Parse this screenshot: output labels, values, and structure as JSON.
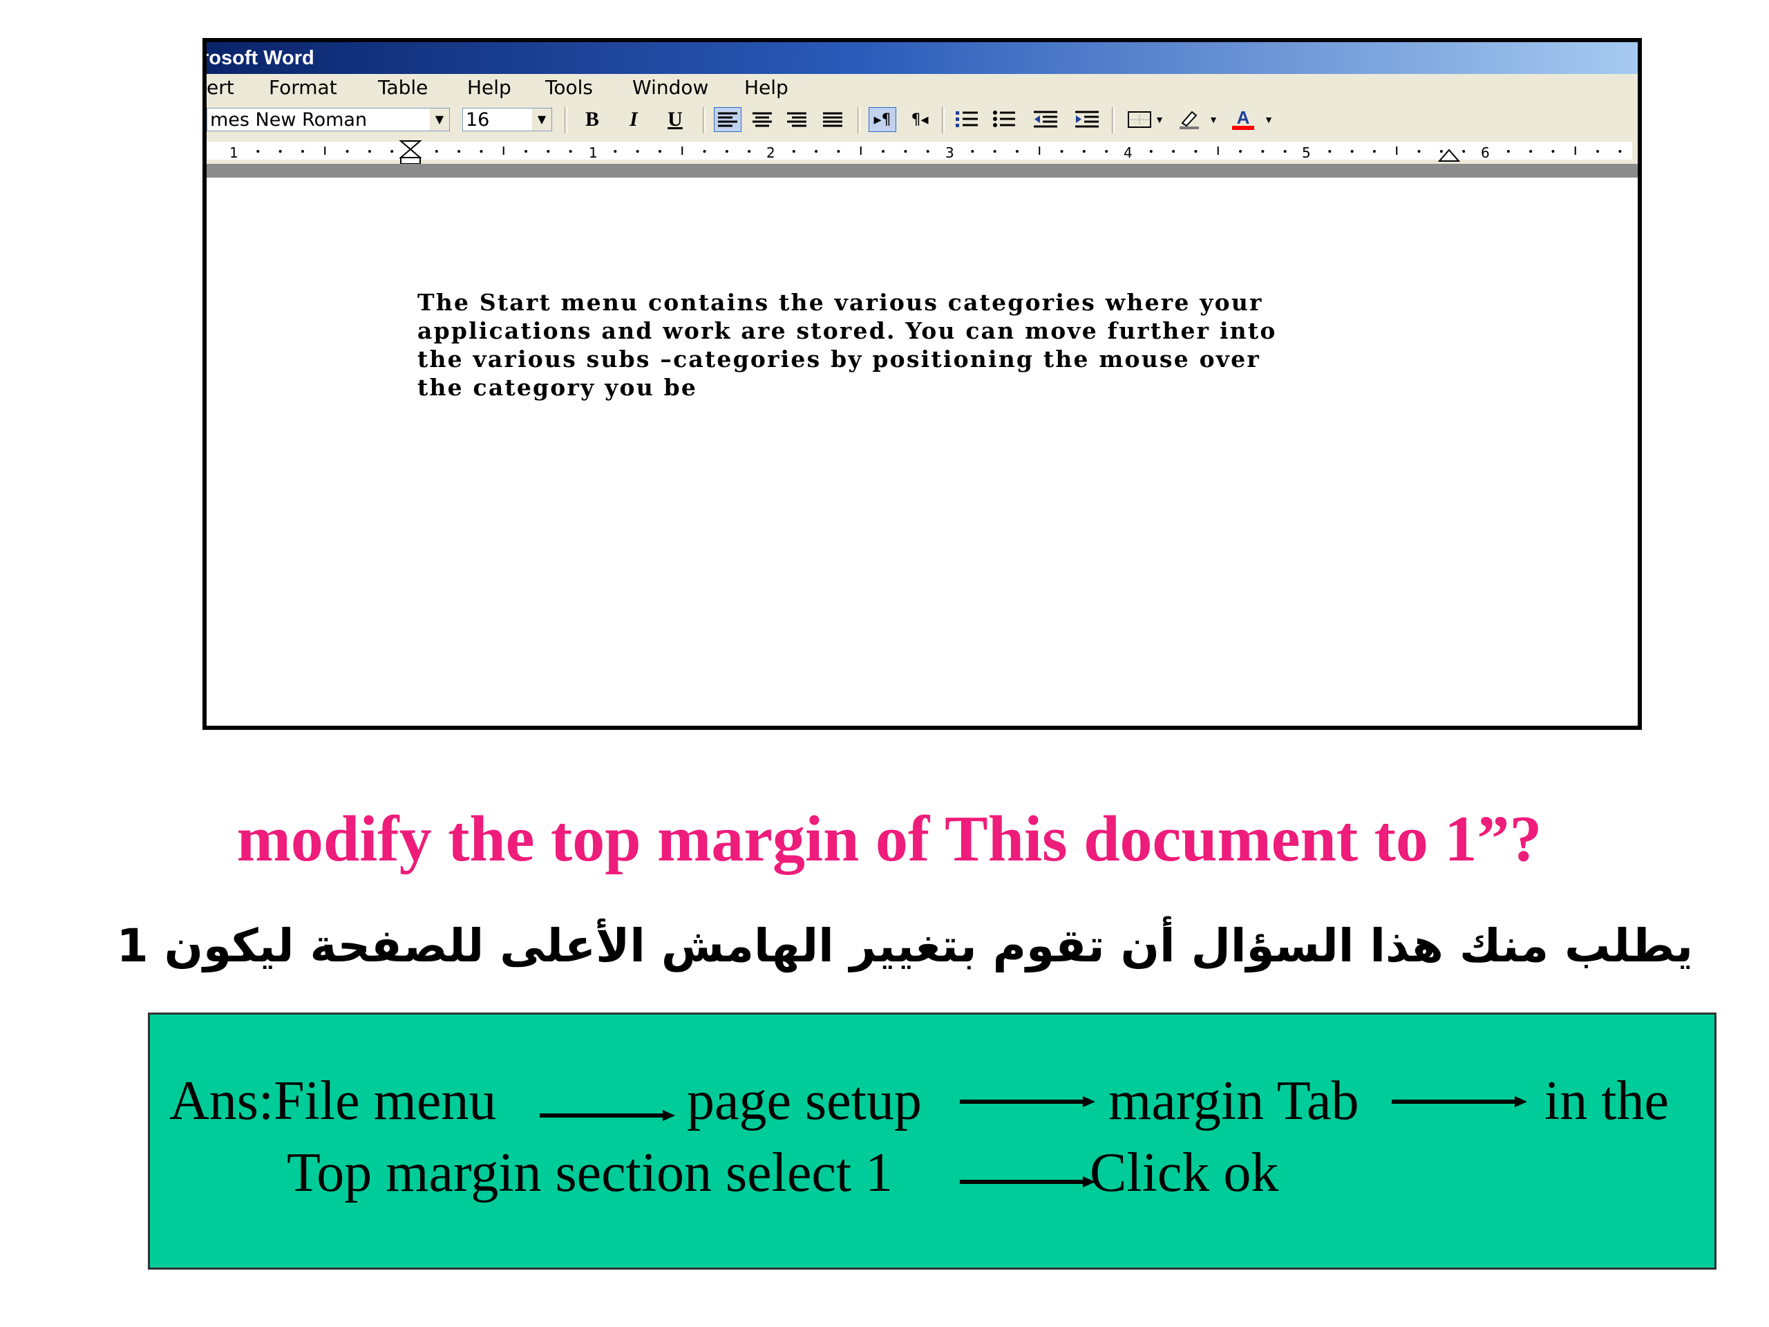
{
  "word_window": {
    "title": "rosoft Word",
    "menu": [
      "ert",
      "Format",
      "Table",
      "Help",
      "Tools",
      "Window",
      "Help"
    ],
    "font_name": "mes New Roman",
    "font_size": "16",
    "format_buttons": {
      "bold": "B",
      "italic": "I",
      "underline": "U"
    },
    "ruler_numbers": [
      "1",
      "1",
      "2",
      "3",
      "4",
      "5",
      "6"
    ],
    "document_text": "The Start menu contains the various categories where your\napplications and work are stored. You can move further into\nthe various subs –categories by positioning the mouse over\nthe category you be",
    "icons": [
      "align-left-icon",
      "align-center-icon",
      "align-right-icon",
      "justify-icon",
      "ltr-icon",
      "rtl-icon",
      "numbered-list-icon",
      "bulleted-list-icon",
      "decrease-indent-icon",
      "increase-indent-icon",
      "borders-icon",
      "highlight-icon",
      "font-color-icon"
    ]
  },
  "question": "modify the top margin of This document to 1”?",
  "arabic_question": "يطلب منك هذا السؤال أن تقوم بتغيير الهامش الأعلى للصفحة ليكون 1",
  "answer": {
    "part1": "Ans:File menu",
    "part2": "page setup",
    "part3": "margin Tab",
    "part4": "in the",
    "part5": "Top margin section select 1",
    "part6": "Click ok"
  },
  "colors": {
    "question": "#ee1c7a",
    "answer_box": "#00cc99",
    "title_bar": "#0a246a"
  }
}
